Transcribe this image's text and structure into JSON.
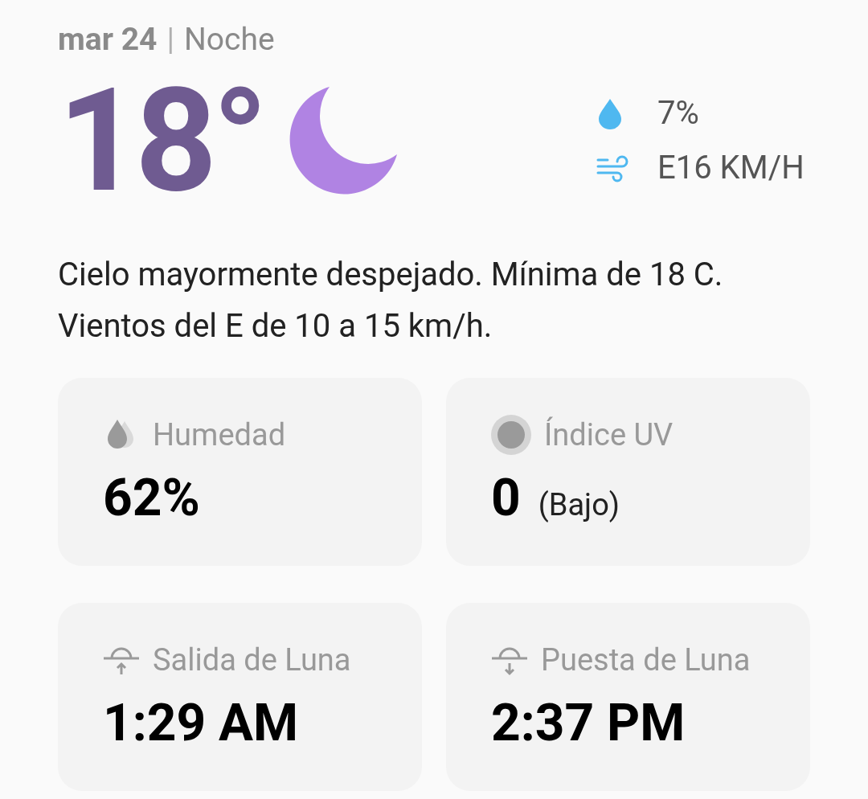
{
  "header": {
    "date": "mar 24",
    "separator": "|",
    "period": "Noche"
  },
  "current": {
    "temperature": "18°"
  },
  "details": [
    {
      "kind": "precipitation",
      "value": "7%"
    },
    {
      "kind": "wind",
      "value": "E16 KM/H"
    }
  ],
  "description": "Cielo mayormente despejado. Mínima de 18 C. Vientos del E de 10 a 15 km/h.",
  "cards": [
    {
      "kind": "humidity",
      "label": "Humedad",
      "value": "62%"
    },
    {
      "kind": "uv",
      "label": "Índice UV",
      "value": "0",
      "note": "(Bajo)"
    },
    {
      "kind": "moonrise",
      "label": "Salida de Luna",
      "value": "1:29 AM"
    },
    {
      "kind": "moonset",
      "label": "Puesta de Luna",
      "value": "2:37 PM"
    }
  ]
}
